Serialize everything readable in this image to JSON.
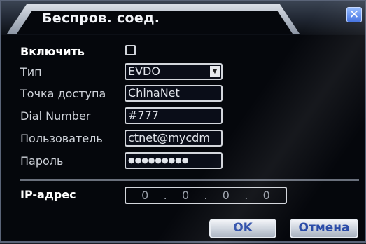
{
  "dialog": {
    "title": "Беспров. соед.",
    "close_glyph": "✕"
  },
  "form": {
    "enable_label": "Включить",
    "enable_checked": false,
    "type_label": "Тип",
    "type_value": "EVDO",
    "ap_label": "Точка доступа",
    "ap_value": "ChinaNet",
    "dial_label": "Dial Number",
    "dial_value": "#777",
    "user_label": "Пользователь",
    "user_value": "ctnet@mycdm",
    "password_label": "Пароль",
    "password_value": "●●●●●●●●●",
    "ip_label": "IP-адрес",
    "ip": {
      "o1": "0",
      "o2": "0",
      "o3": "0",
      "o4": "0"
    }
  },
  "buttons": {
    "ok": "OK",
    "cancel": "Отмена"
  },
  "colors": {
    "background": "#05070c",
    "field_border": "#d3d6dc",
    "button_text": "#2b4ca8"
  }
}
